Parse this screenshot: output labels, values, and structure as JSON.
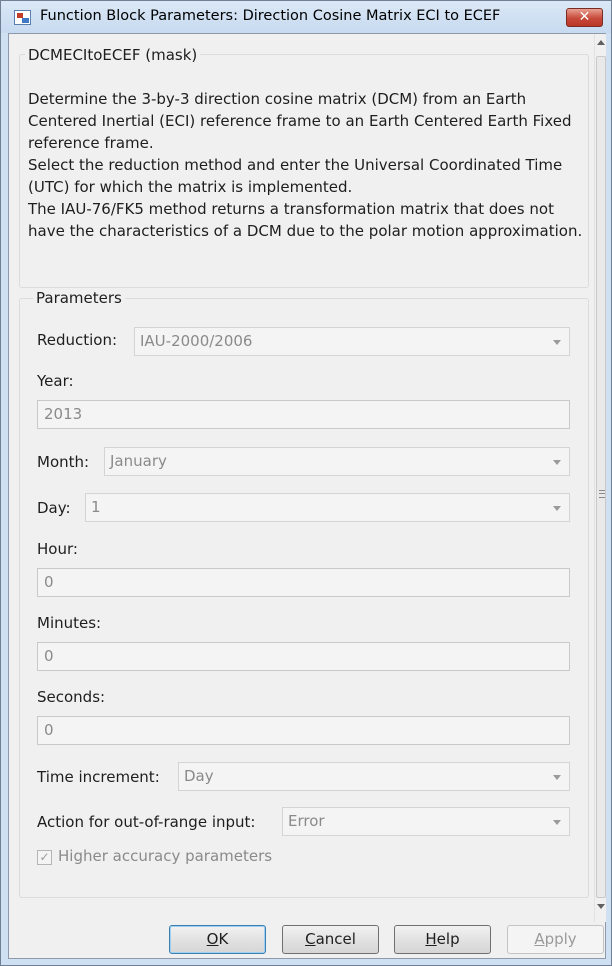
{
  "window": {
    "title": "Function Block Parameters: Direction Cosine Matrix ECI to ECEF",
    "close_label": "✕"
  },
  "mask": {
    "title": "DCMECItoECEF (mask)",
    "description": [
      "Determine the 3-by-3 direction cosine matrix (DCM) from an Earth Centered Inertial (ECI) reference frame to an Earth Centered Earth Fixed reference frame.",
      "Select the reduction method and enter the Universal Coordinated Time (UTC) for which the matrix is implemented.",
      "The IAU-76/FK5 method returns a transformation matrix that does not have the characteristics of a DCM due to the polar motion approximation."
    ]
  },
  "parameters": {
    "title": "Parameters",
    "reduction": {
      "label": "Reduction:",
      "value": "IAU-2000/2006"
    },
    "year": {
      "label": "Year:",
      "value": "2013"
    },
    "month": {
      "label": "Month:",
      "value": "January"
    },
    "day": {
      "label": "Day:",
      "value": "1"
    },
    "hour": {
      "label": "Hour:",
      "value": "0"
    },
    "minutes": {
      "label": "Minutes:",
      "value": "0"
    },
    "seconds": {
      "label": "Seconds:",
      "value": "0"
    },
    "time_increment": {
      "label": "Time increment:",
      "value": "Day"
    },
    "action_out_of_range": {
      "label": "Action for out-of-range input:",
      "value": "Error"
    },
    "higher_accuracy": {
      "label": "Higher accuracy parameters",
      "checked": true,
      "check_glyph": "✓"
    }
  },
  "buttons": {
    "ok": {
      "mnemonic": "O",
      "rest": "K"
    },
    "cancel": {
      "mnemonic": "C",
      "rest": "ancel"
    },
    "help": {
      "mnemonic": "H",
      "rest": "elp"
    },
    "apply": {
      "mnemonic": "A",
      "rest": "pply"
    }
  },
  "colors": {
    "title_bar": "#c7daf0",
    "close_button": "#c74a3a",
    "dialog_background": "#f0f0f0",
    "disabled_text": "#8a8a8a"
  }
}
